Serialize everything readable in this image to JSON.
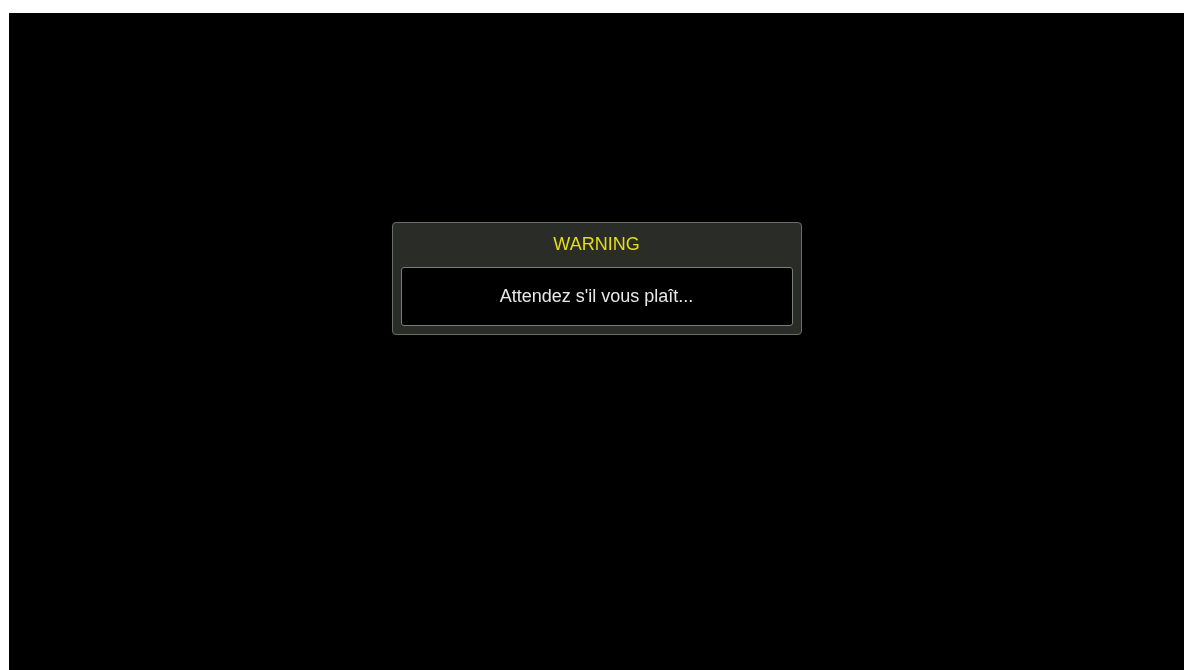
{
  "dialog": {
    "title": "WARNING",
    "message": "Attendez s'il vous plaît..."
  }
}
